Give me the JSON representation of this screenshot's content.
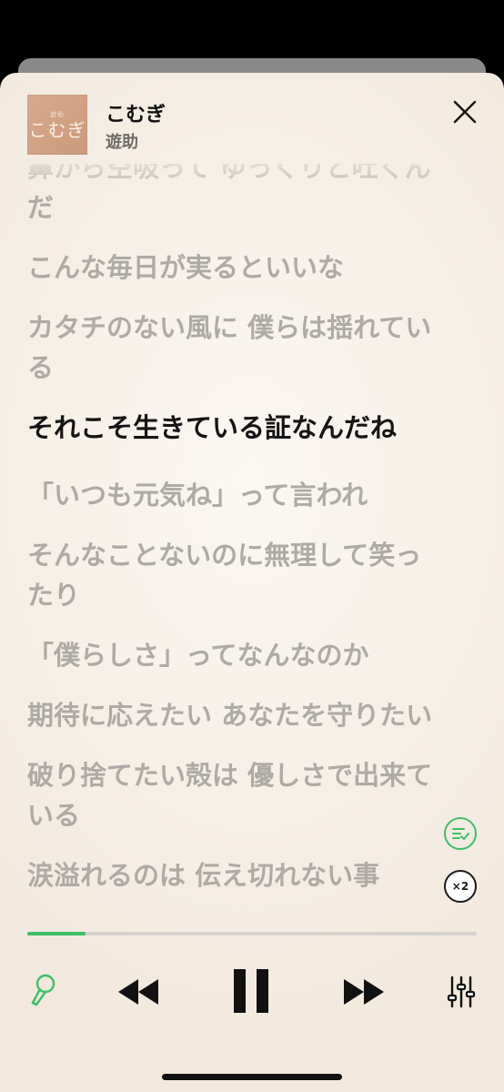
{
  "player": {
    "title": "こむぎ",
    "artist": "遊助",
    "artwork_text": "こむぎ",
    "artwork_small": "遊助"
  },
  "lyrics": [
    {
      "text": "鼻から空吸って ゆっくりと吐くんだ",
      "active": false
    },
    {
      "text": "こんな毎日が実るといいな",
      "active": false
    },
    {
      "text": "カタチのない風に 僕らは揺れている",
      "active": false
    },
    {
      "text": "それこそ生きている証なんだね",
      "active": true
    },
    {
      "text": "「いつも元気ね」って言われ",
      "active": false
    },
    {
      "text": "そんなことないのに無理して笑ったり",
      "active": false
    },
    {
      "text": "「僕らしさ」ってなんなのか",
      "active": false
    },
    {
      "text": "期待に応えたい あなたを守りたい",
      "active": false
    },
    {
      "text": "破り捨てたい殻は 優しさで出来ている",
      "active": false
    },
    {
      "text": "涙溢れるのは 伝え切れない事",
      "active": false
    }
  ],
  "playback": {
    "progress": 0.13,
    "speed_label": "×2"
  },
  "icons": {
    "close": "close-icon",
    "lyrics_mode": "lyrics-list-icon",
    "mic": "microphone-icon",
    "rewind": "rewind-icon",
    "pause": "pause-icon",
    "forward": "fast-forward-icon",
    "equalizer": "equalizer-icon"
  },
  "colors": {
    "accent": "#3fbf67",
    "active_lyric": "#141414",
    "inactive_lyric": "#aeaaa5",
    "background": "#f6efe6"
  }
}
